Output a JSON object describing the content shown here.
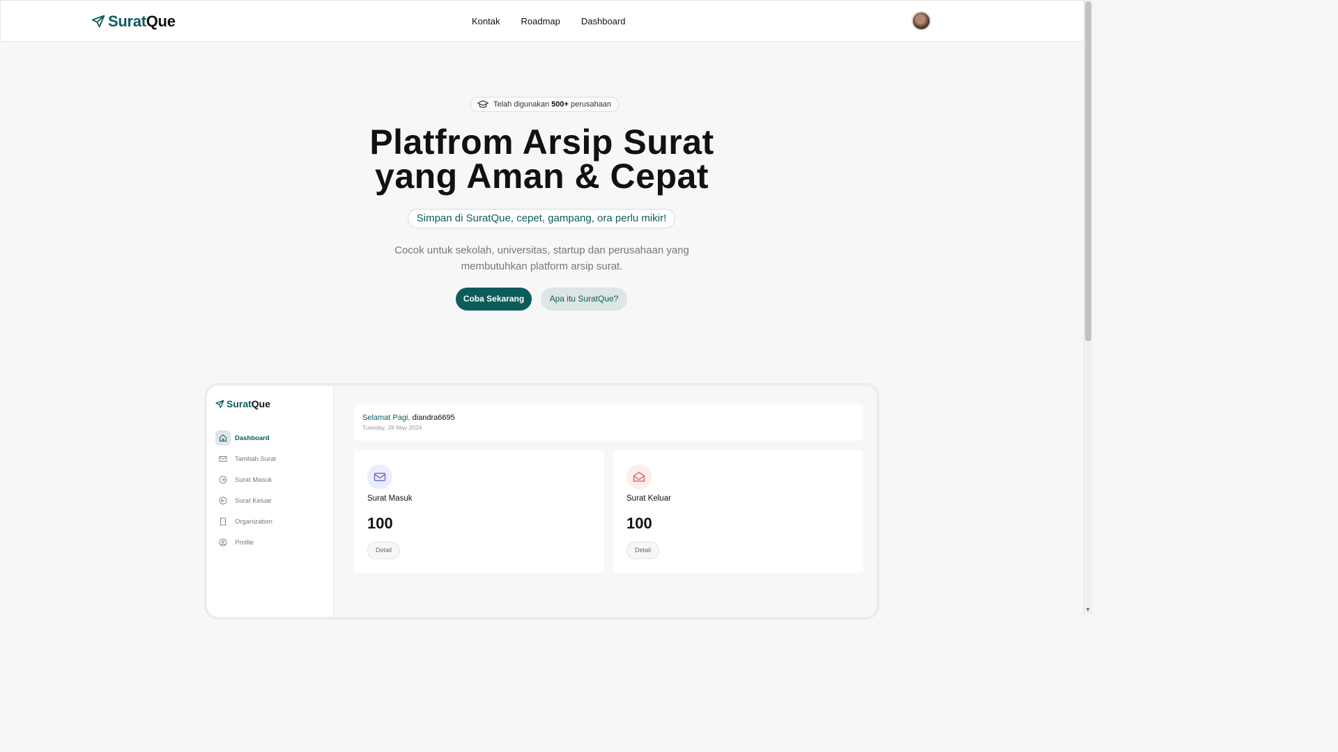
{
  "header": {
    "logo_a": "Surat",
    "logo_b": "Que",
    "nav": [
      "Kontak",
      "Roadmap",
      "Dashboard"
    ]
  },
  "hero": {
    "badge_prefix": "Telah digunakan ",
    "badge_bold": "500+",
    "badge_suffix": " perusahaan",
    "title_line1": "Platfrom Arsip Surat",
    "title_line2": "yang Aman & Cepat",
    "tagline": "Simpan di SuratQue, cepet, gampang, ora perlu mikir!",
    "description": "Cocok untuk sekolah, universitas, startup dan perusahaan yang membutuhkan platform arsip surat.",
    "cta_primary": "Coba Sekarang",
    "cta_secondary": "Apa itu SuratQue?"
  },
  "preview": {
    "logo_a": "Surat",
    "logo_b": "Que",
    "menu": [
      "Dashboard",
      "Tambah Surat",
      "Surat Masuk",
      "Surat Keluar",
      "Organization",
      "Profile"
    ],
    "greeting": "Selamat Pagi,",
    "username": " diandra6695",
    "date": "Tuesday, 28 May 2024",
    "cards": [
      {
        "title": "Surat Masuk",
        "value": "100",
        "button": "Detail"
      },
      {
        "title": "Surat Keluar",
        "value": "100",
        "button": "Detail"
      }
    ]
  },
  "colors": {
    "brand": "#0d5c5c",
    "incoming_icon": "#6b6fd6",
    "outgoing_icon": "#e06a6a"
  }
}
